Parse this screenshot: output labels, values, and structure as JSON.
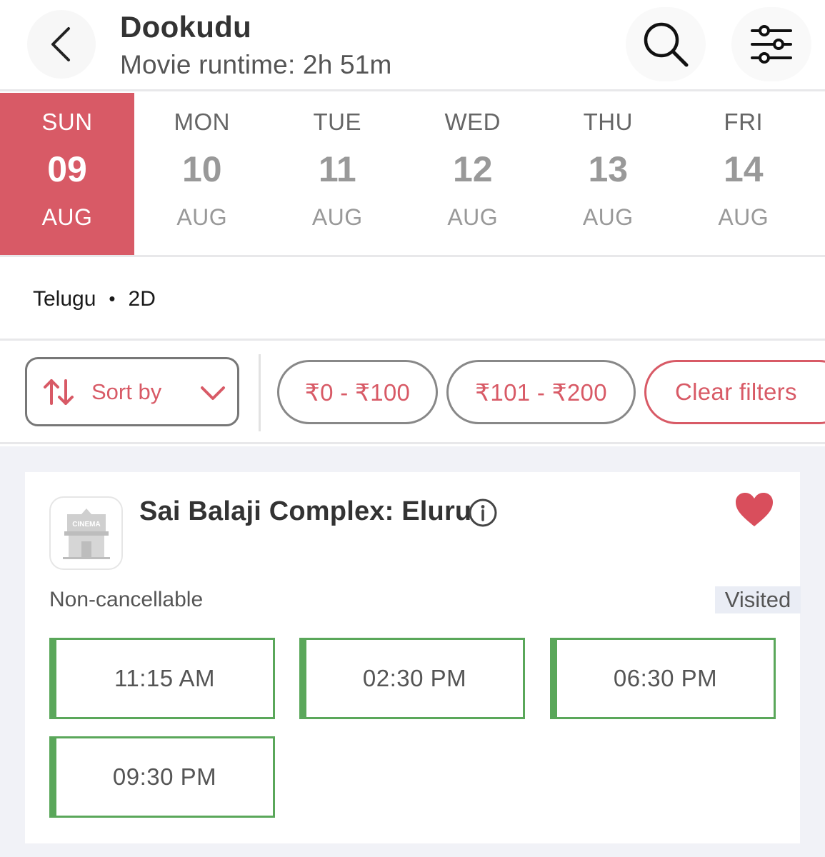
{
  "header": {
    "title": "Dookudu",
    "subtitle": "Movie runtime: 2h 51m",
    "icons": {
      "back": "chevron-left-icon",
      "search": "search-icon",
      "filter": "sliders-icon"
    }
  },
  "dates": [
    {
      "dow": "SUN",
      "day": "09",
      "month": "AUG",
      "selected": true
    },
    {
      "dow": "MON",
      "day": "10",
      "month": "AUG",
      "selected": false
    },
    {
      "dow": "TUE",
      "day": "11",
      "month": "AUG",
      "selected": false
    },
    {
      "dow": "WED",
      "day": "12",
      "month": "AUG",
      "selected": false
    },
    {
      "dow": "THU",
      "day": "13",
      "month": "AUG",
      "selected": false
    },
    {
      "dow": "FRI",
      "day": "14",
      "month": "AUG",
      "selected": false
    }
  ],
  "format": {
    "language": "Telugu",
    "separator": "•",
    "dimension": "2D"
  },
  "filters": {
    "sort_label": "Sort by",
    "price_range_1": "₹0 - ₹100",
    "price_range_2": "₹101 - ₹200",
    "clear_label": "Clear filters"
  },
  "cinema": {
    "name": "Sai Balaji Complex: Eluru",
    "logo_text": "CINEMA",
    "cancellation": "Non-cancellable",
    "badge": "Visited",
    "favorite": true,
    "showtimes": [
      "11:15 AM",
      "02:30 PM",
      "06:30 PM",
      "09:30 PM"
    ]
  },
  "colors": {
    "accent": "#d85a66",
    "available": "#5aa75a",
    "list_bg": "#f1f2f7"
  }
}
